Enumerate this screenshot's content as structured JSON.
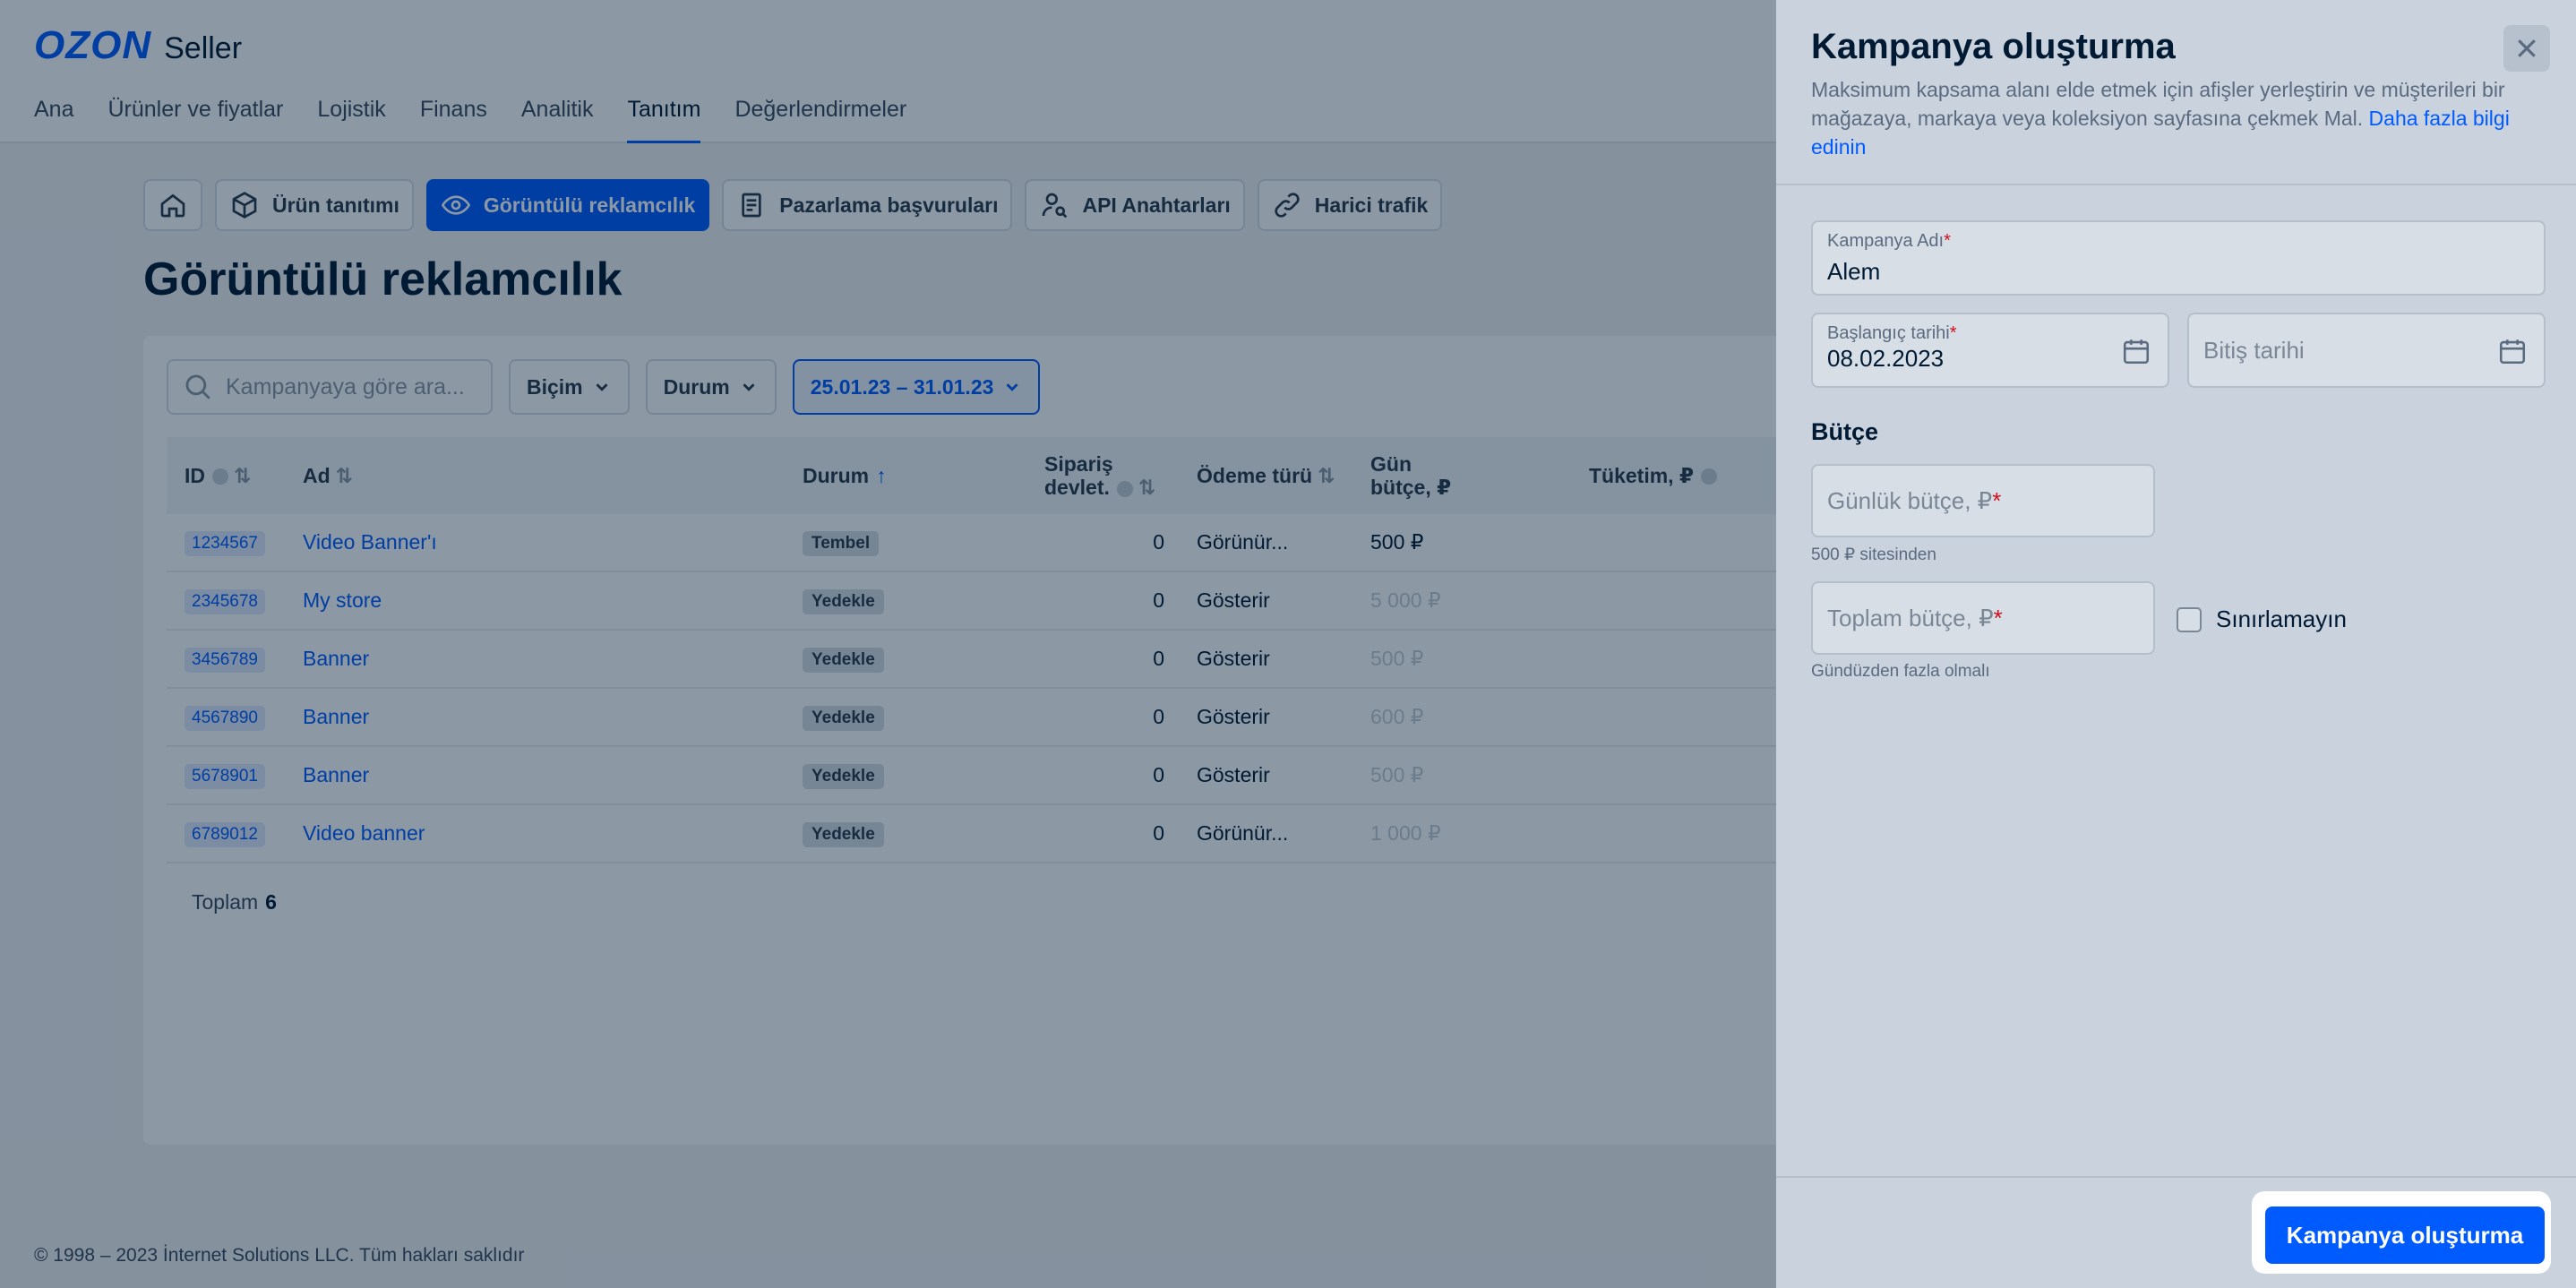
{
  "brand": {
    "logo": "OZON",
    "product": "Seller"
  },
  "nav": [
    "Ana",
    "Ürünler ve fiyatlar",
    "Lojistik",
    "Finans",
    "Analitik",
    "Tanıtım",
    "Değerlendirmeler"
  ],
  "nav_active": "Tanıtım",
  "subtabs": {
    "product_promo": "Ürün tanıtımı",
    "display_ads": "Görüntülü reklamcılık",
    "marketing": "Pazarlama başvuruları",
    "api_keys": "API Anahtarları",
    "external": "Harici trafik"
  },
  "page_title": "Görüntülü reklamcılık",
  "filters": {
    "search_placeholder": "Kampanyaya göre ara...",
    "format": "Biçim",
    "status": "Durum",
    "date_range": "25.01.23 – 31.01.23"
  },
  "table": {
    "headers": {
      "id": "ID",
      "name": "Ad",
      "status": "Durum",
      "orders_line1": "Sipariş",
      "orders_line2": "devlet.",
      "payment": "Ödeme türü",
      "daily_line1": "Gün",
      "daily_line2": "bütçe, ₽",
      "spend": "Tüketim, ₽"
    },
    "rows": [
      {
        "id": "1234567",
        "name": "Video Banner'ı",
        "status": "Tembel",
        "orders": "0",
        "payment": "Görünür...",
        "daily": "500 ₽",
        "daily_muted": false
      },
      {
        "id": "2345678",
        "name": "My store",
        "status": "Yedekle",
        "orders": "0",
        "payment": "Gösterir",
        "daily": "5 000 ₽",
        "daily_muted": true
      },
      {
        "id": "3456789",
        "name": "Banner",
        "status": "Yedekle",
        "orders": "0",
        "payment": "Gösterir",
        "daily": "500 ₽",
        "daily_muted": true
      },
      {
        "id": "4567890",
        "name": "Banner",
        "status": "Yedekle",
        "orders": "0",
        "payment": "Gösterir",
        "daily": "600 ₽",
        "daily_muted": true
      },
      {
        "id": "5678901",
        "name": "Banner",
        "status": "Yedekle",
        "orders": "0",
        "payment": "Gösterir",
        "daily": "500 ₽",
        "daily_muted": true
      },
      {
        "id": "6789012",
        "name": "Video banner",
        "status": "Yedekle",
        "orders": "0",
        "payment": "Görünür...",
        "daily": "1 000 ₽",
        "daily_muted": true
      }
    ],
    "total_label": "Toplam",
    "total_value": "6"
  },
  "footer": "© 1998 – 2023 İnternet Solutions LLC. Tüm hakları saklıdır",
  "panel": {
    "title": "Kampanya oluşturma",
    "description": "Maksimum kapsama alanı elde etmek için afişler yerleştirin ve müşterileri bir mağazaya, markaya veya koleksiyon sayfasına çekmek Mal.",
    "learn_more": "Daha fazla bilgi edinin",
    "campaign_name_label": "Kampanya Adı",
    "campaign_name_value": "Alem",
    "start_date_label": "Başlangıç tarihi",
    "start_date_value": "08.02.2023",
    "end_date_placeholder": "Bitiş tarihi",
    "budget_title": "Bütçe",
    "daily_budget_placeholder": "Günlük bütçe, ₽",
    "daily_budget_hint": "500 ₽ sitesinden",
    "total_budget_placeholder": "Toplam bütçe, ₽",
    "total_budget_hint": "Gündüzden fazla olmalı",
    "unlimited_label": "Sınırlamayın",
    "submit_label": "Kampanya oluşturma"
  },
  "colors": {
    "accent": "#005bff",
    "required": "#d0101e",
    "overlay": "rgba(0,26,52,0.45)"
  }
}
